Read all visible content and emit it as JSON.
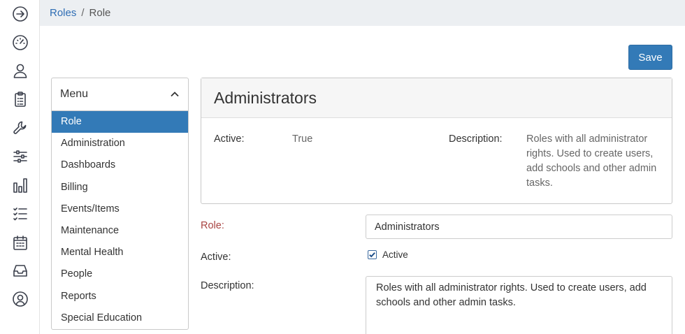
{
  "breadcrumb": {
    "parent": "Roles",
    "separator": "/",
    "current": "Role"
  },
  "toolbar": {
    "save_label": "Save"
  },
  "menu": {
    "title": "Menu",
    "items": [
      {
        "label": "Role",
        "active": true
      },
      {
        "label": "Administration"
      },
      {
        "label": "Dashboards"
      },
      {
        "label": "Billing"
      },
      {
        "label": "Events/Items"
      },
      {
        "label": "Maintenance"
      },
      {
        "label": "Mental Health"
      },
      {
        "label": "People"
      },
      {
        "label": "Reports"
      },
      {
        "label": "Special Education"
      }
    ]
  },
  "details": {
    "title": "Administrators",
    "active_label": "Active:",
    "active_value": "True",
    "description_label": "Description:",
    "description_value": "Roles with all administrator rights. Used to create users, add schools and other admin tasks."
  },
  "form": {
    "role_label": "Role:",
    "role_value": "Administrators",
    "active_label": "Active:",
    "active_checkbox_label": "Active",
    "active_checked": true,
    "description_label": "Description:",
    "description_value": "Roles with all administrator rights. Used to create users, add schools and other admin tasks."
  },
  "rail_icons": [
    "arrow-right-circle-icon",
    "dashboard-gauge-icon",
    "user-icon",
    "clipboard-icon",
    "wrench-icon",
    "sliders-icon",
    "bar-chart-icon",
    "checklist-icon",
    "calendar-icon",
    "inbox-icon",
    "user-circle-icon"
  ],
  "colors": {
    "primary": "#337ab7",
    "link": "#2e6db4",
    "required": "#a94442",
    "breadcrumb_bg": "#eceff2"
  }
}
